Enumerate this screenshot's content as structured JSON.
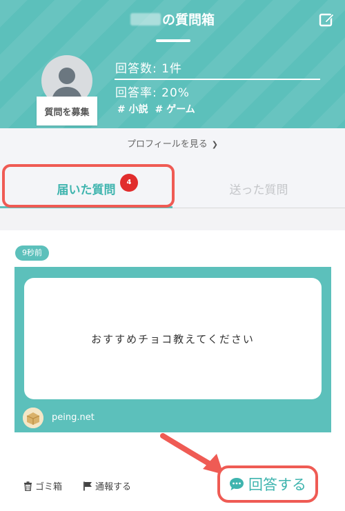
{
  "header": {
    "title_suffix": "の質問箱",
    "stats": {
      "answers": "回答数: 1件",
      "rate": "回答率: 20%"
    },
    "tags": [
      "# 小説",
      "# ゲーム"
    ],
    "recruit_label": "質問を募集"
  },
  "profile_link": "プロフィールを見る",
  "tabs": {
    "received": "届いた質問",
    "received_badge": "4",
    "sent": "送った質問"
  },
  "question": {
    "time": "9秒前",
    "text": "おすすめチョコ教えてください",
    "source": "peing.net"
  },
  "actions": {
    "trash": "ゴミ箱",
    "report": "通報する",
    "answer": "回答する"
  },
  "colors": {
    "accent": "#5cc0bb",
    "highlight": "#ef5b54",
    "badge": "#e12d2d"
  }
}
